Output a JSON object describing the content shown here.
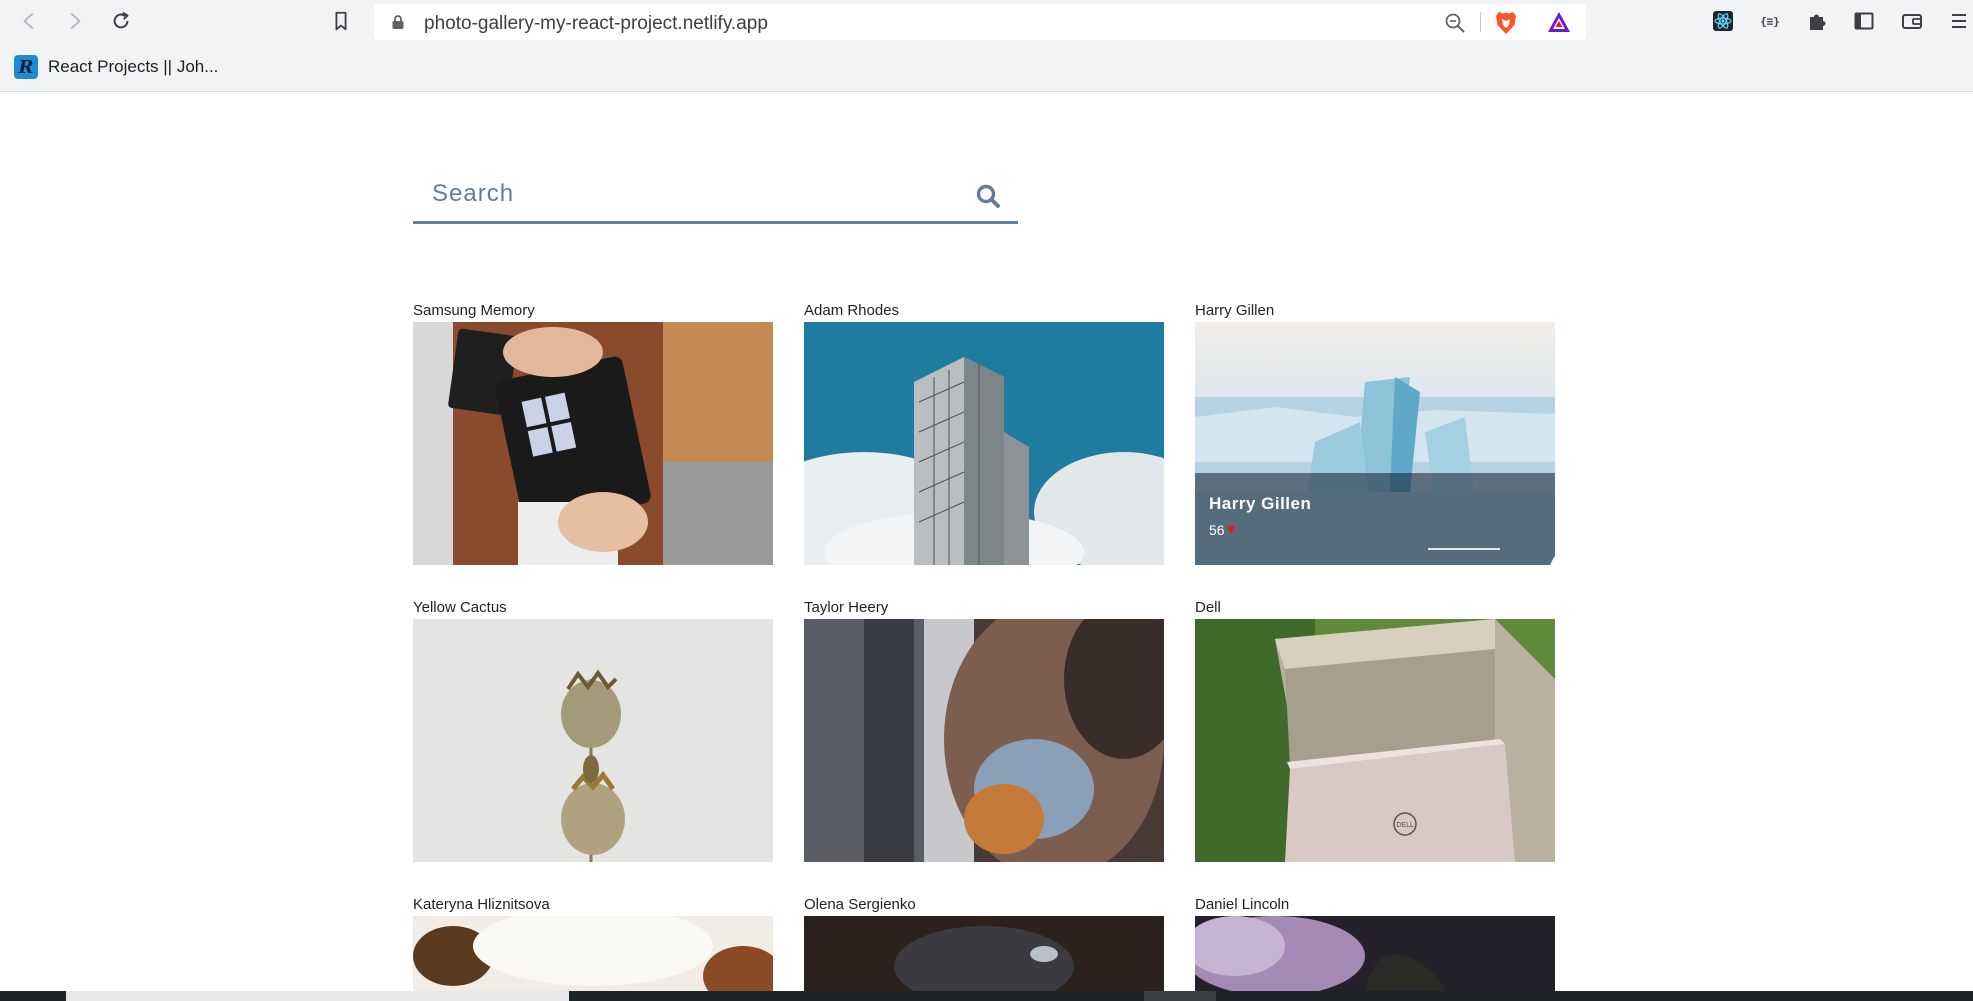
{
  "browser": {
    "url": "photo-gallery-my-react-project.netlify.app",
    "bookmark_label": "React Projects || Joh...",
    "bookmark_favicon_letter": "R",
    "extension_icons": [
      "react-devtools-icon",
      "json-formatter-icon",
      "extensions-puzzle-icon",
      "sidebar-icon",
      "wallet-icon",
      "menu-icon"
    ]
  },
  "search": {
    "placeholder": "Search",
    "icon": "search-icon",
    "accent_color": "#617d98"
  },
  "photos": [
    {
      "name": "Samsung Memory",
      "subject": "memory-cards-desk"
    },
    {
      "name": "Adam Rhodes",
      "subject": "skyscraper-clouds"
    },
    {
      "name": "Harry Gillen",
      "subject": "ice-landscape",
      "hover": {
        "name": "Harry Gillen",
        "likes": "56"
      }
    },
    {
      "name": "Yellow Cactus",
      "subject": "dried-poppy"
    },
    {
      "name": "Taylor Heery",
      "subject": "blurred-couple"
    },
    {
      "name": "Dell",
      "subject": "laptop-outdoors"
    },
    {
      "name": "Kateryna Hliznitsova",
      "subject": "white-sweater"
    },
    {
      "name": "Olena Sergienko",
      "subject": "person-cap"
    },
    {
      "name": "Daniel Lincoln",
      "subject": "purple-smoke"
    }
  ]
}
